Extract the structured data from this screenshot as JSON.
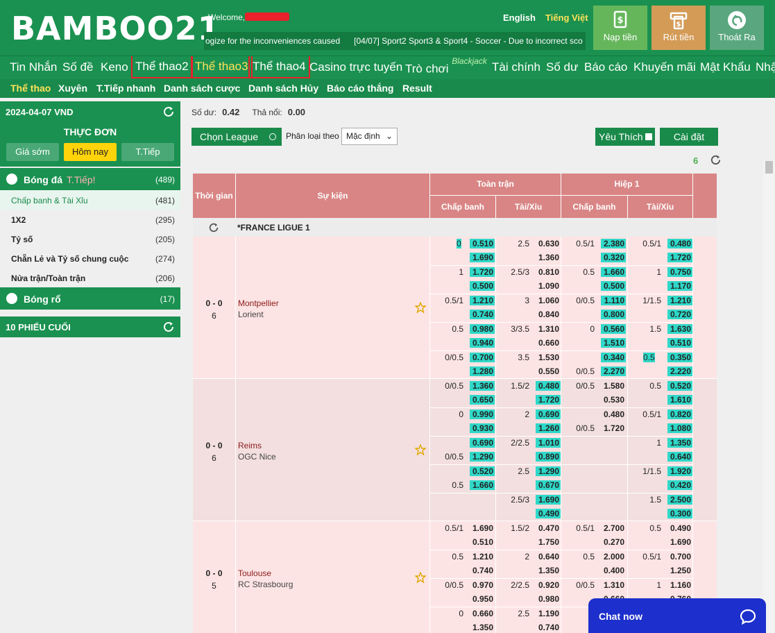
{
  "header": {
    "logo": "BAMBOO21",
    "welcome": "Welcome,",
    "ticker": [
      "ogize for the inconveniences caused",
      "[04/07] Sport2 Sport3 & Sport4 - Soccer - Due to incorrect sco"
    ],
    "lang_en": "English",
    "lang_vn": "Tiếng Việt",
    "deposit": "Nạp tiền",
    "withdraw": "Rút tiền",
    "logout": "Thoát Ra"
  },
  "nav": [
    "Tin Nhắn",
    "Số đề",
    "Keno",
    "Thể thao2",
    "Thể thao3",
    "Thể thao4",
    "Casino trực tuyến",
    "Trò chơi",
    "Tài chính",
    "Số dư",
    "Báo cáo",
    "Khuyến mãi",
    "Mật Khẩu",
    "Nhậ"
  ],
  "nav_badge": "Blackjack",
  "subnav": [
    "Thể thao",
    "Xuyên",
    "T.Tiếp nhanh",
    "Danh sách cược",
    "Danh sách Hủy",
    "Báo cáo thắng",
    "Result"
  ],
  "sidebar": {
    "date": "2024-04-07 VND",
    "menu_title": "THỰC ĐƠN",
    "tabs": [
      "Giá sớm",
      "Hôm nay",
      "T.Tiếp"
    ],
    "football": "Bóng đá",
    "live": "T.Tiếp!",
    "football_count": "(489)",
    "items": [
      {
        "label": "Chấp banh & Tài Xỉu",
        "count": "(481)"
      },
      {
        "label": "1X2",
        "count": "(295)"
      },
      {
        "label": "Tỷ số",
        "count": "(205)"
      },
      {
        "label": "Chẵn Lẻ và Tỷ số chung cuộc",
        "count": "(274)"
      },
      {
        "label": "Nửa trận/Toàn trận",
        "count": "(206)"
      }
    ],
    "basketball": "Bóng rổ",
    "basketball_count": "(17)",
    "last10": "10 PHIẾU CUỐI"
  },
  "main": {
    "balance_label": "Số dư:",
    "balance": "0.42",
    "outstanding_label": "Thả nổi:",
    "outstanding": "0.00",
    "choose_league": "Chọn League",
    "sort_label": "Phân loại theo",
    "sort_value": "Mặc định",
    "favorites": "Yêu Thích",
    "settings": "Cài đặt",
    "count": "6"
  },
  "table": {
    "h_time": "Thời gian",
    "h_event": "Sự kiện",
    "h_full": "Toàn trận",
    "h_half": "Hiệp 1",
    "h_hdp": "Chấp banh",
    "h_ou": "Tài/Xỉu",
    "h_hdp2": "Chấp banh",
    "h_ou2": "Tài/Xỉu",
    "league": "*FRANCE LIGUE 1"
  },
  "matches": [
    {
      "score": "0 - 0",
      "min": "6",
      "home": "Montpellier",
      "away": "Lorient",
      "rows": [
        [
          [
            "0",
            "0.510",
            "",
            "1.690",
            1,
            1,
            1
          ],
          [
            "2.5",
            "0.630",
            "",
            "1.360",
            0,
            0,
            0
          ],
          [
            "0.5/1",
            "2.380",
            "",
            "0.320",
            0,
            1,
            1
          ],
          [
            "0.5/1",
            "0.480",
            "",
            "1.720",
            0,
            1,
            1
          ]
        ],
        [
          [
            "1",
            "1.720",
            "",
            "0.500",
            0,
            1,
            1
          ],
          [
            "2.5/3",
            "0.810",
            "",
            "1.090",
            0,
            0,
            0
          ],
          [
            "0.5",
            "1.660",
            "",
            "0.500",
            0,
            1,
            1
          ],
          [
            "1",
            "0.750",
            "",
            "1.170",
            0,
            1,
            1
          ]
        ],
        [
          [
            "0.5/1",
            "1.210",
            "",
            "0.740",
            0,
            1,
            1
          ],
          [
            "3",
            "1.060",
            "",
            "0.840",
            0,
            0,
            0
          ],
          [
            "0/0.5",
            "1.110",
            "",
            "0.800",
            0,
            1,
            1
          ],
          [
            "1/1.5",
            "1.210",
            "",
            "0.720",
            0,
            1,
            1
          ]
        ],
        [
          [
            "0.5",
            "0.980",
            "",
            "0.940",
            0,
            1,
            1
          ],
          [
            "3/3.5",
            "1.310",
            "",
            "0.660",
            0,
            0,
            0
          ],
          [
            "0",
            "0.560",
            "",
            "1.510",
            0,
            1,
            1
          ],
          [
            "1.5",
            "1.630",
            "",
            "0.510",
            0,
            1,
            1
          ]
        ],
        [
          [
            "0/0.5",
            "0.700",
            "",
            "1.280",
            0,
            1,
            1
          ],
          [
            "3.5",
            "1.530",
            "",
            "0.550",
            0,
            0,
            0
          ],
          [
            "",
            "0.340",
            "0/0.5",
            "2.270",
            0,
            1,
            1
          ],
          [
            "0.5",
            "0.350",
            "",
            "2.220",
            1,
            1,
            1
          ]
        ]
      ]
    },
    {
      "score": "0 - 0",
      "min": "6",
      "home": "Reims",
      "away": "OGC Nice",
      "rows": [
        [
          [
            "0/0.5",
            "1.360",
            "",
            "0.650",
            0,
            1,
            1
          ],
          [
            "1.5/2",
            "0.480",
            "",
            "1.720",
            0,
            1,
            1
          ],
          [
            "0/0.5",
            "1.580",
            "",
            "0.530",
            0,
            0,
            0
          ],
          [
            "0.5",
            "0.520",
            "",
            "1.610",
            0,
            1,
            1
          ]
        ],
        [
          [
            "0",
            "0.990",
            "",
            "0.930",
            0,
            1,
            1
          ],
          [
            "2",
            "0.690",
            "",
            "1.260",
            0,
            1,
            1
          ],
          [
            "",
            "0.480",
            "0/0.5",
            "1.720",
            0,
            0,
            0
          ],
          [
            "0.5/1",
            "0.820",
            "",
            "1.080",
            0,
            1,
            1
          ]
        ],
        [
          [
            "",
            "0.690",
            "0/0.5",
            "1.290",
            0,
            1,
            1
          ],
          [
            "2/2.5",
            "1.010",
            "",
            "0.890",
            0,
            1,
            1
          ],
          [
            "",
            "",
            "",
            "",
            0,
            0,
            0
          ],
          [
            "1",
            "1.350",
            "",
            "0.640",
            0,
            1,
            1
          ]
        ],
        [
          [
            "",
            "0.520",
            "0.5",
            "1.660",
            0,
            1,
            1
          ],
          [
            "2.5",
            "1.290",
            "",
            "0.670",
            0,
            1,
            1
          ],
          [
            "",
            "",
            "",
            "",
            0,
            0,
            0
          ],
          [
            "1/1.5",
            "1.920",
            "",
            "0.420",
            0,
            1,
            1
          ]
        ],
        [
          [
            "",
            "",
            "",
            "",
            0,
            0,
            0
          ],
          [
            "2.5/3",
            "1.690",
            "",
            "0.490",
            0,
            1,
            1
          ],
          [
            "",
            "",
            "",
            "",
            0,
            0,
            0
          ],
          [
            "1.5",
            "2.500",
            "",
            "0.300",
            0,
            1,
            1
          ]
        ]
      ]
    },
    {
      "score": "0 - 0",
      "min": "5",
      "home": "Toulouse",
      "away": "RC Strasbourg",
      "rows": [
        [
          [
            "0.5/1",
            "1.690",
            "",
            "0.510",
            0,
            0,
            0
          ],
          [
            "1.5/2",
            "0.470",
            "",
            "1.750",
            0,
            0,
            0
          ],
          [
            "0.5/1",
            "2.700",
            "",
            "0.270",
            0,
            0,
            0
          ],
          [
            "0.5",
            "0.490",
            "",
            "1.690",
            0,
            0,
            0
          ]
        ],
        [
          [
            "0.5",
            "1.210",
            "",
            "0.740",
            0,
            0,
            0
          ],
          [
            "2",
            "0.640",
            "",
            "1.350",
            0,
            0,
            0
          ],
          [
            "0.5",
            "2.000",
            "",
            "0.400",
            0,
            0,
            0
          ],
          [
            "0.5/1",
            "0.700",
            "",
            "1.250",
            0,
            0,
            0
          ]
        ],
        [
          [
            "0/0.5",
            "0.970",
            "",
            "0.950",
            0,
            0,
            0
          ],
          [
            "2/2.5",
            "0.920",
            "",
            "0.980",
            0,
            0,
            0
          ],
          [
            "0/0.5",
            "1.310",
            "",
            "0.660",
            0,
            0,
            0
          ],
          [
            "1",
            "1.160",
            "",
            "0.760",
            0,
            0,
            0
          ]
        ],
        [
          [
            "0",
            "0.660",
            "",
            "1.350",
            0,
            0,
            0
          ],
          [
            "2.5",
            "1.190",
            "",
            "0.740",
            0,
            0,
            0
          ],
          [
            "",
            "",
            "",
            "",
            0,
            0,
            0
          ],
          [
            "",
            "",
            "",
            "",
            0,
            0,
            0
          ]
        ]
      ]
    }
  ],
  "chat": {
    "label": "Chat now"
  }
}
